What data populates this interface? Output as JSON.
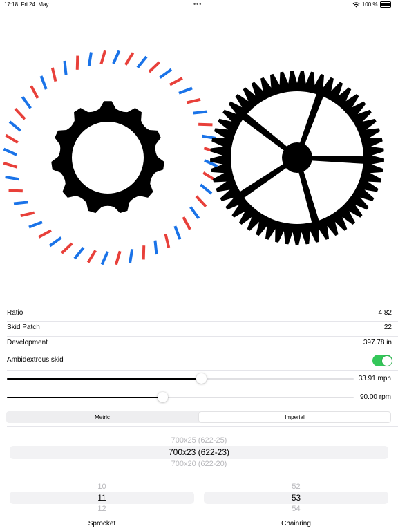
{
  "status_bar": {
    "time": "17:18",
    "date": "Fri 24. May",
    "dots": "•••",
    "battery": "100 %"
  },
  "colors": {
    "accent_red": "#e8403a",
    "accent_blue": "#1a73e8",
    "toggle_on": "#34c759"
  },
  "stats": {
    "ratio_label": "Ratio",
    "ratio_value": "4.82",
    "skid_label": "Skid Patch",
    "skid_value": "22",
    "development_label": "Development",
    "development_value": "397.78 in",
    "ambidextrous_label": "Ambidextrous skid",
    "ambidextrous_on": true
  },
  "sliders": {
    "speed_value": "33.91 mph",
    "speed_fraction": 0.56,
    "cadence_value": "90.00 rpm",
    "cadence_fraction": 0.45
  },
  "units": {
    "metric": "Metric",
    "imperial": "Imperial",
    "selected": "Imperial"
  },
  "tire_picker": {
    "above": "700x25 (622-25)",
    "selected": "700x23 (622-23)",
    "below": "700x20 (622-20)"
  },
  "sprocket_picker": {
    "above": "10",
    "selected": "11",
    "below": "12",
    "label": "Sprocket"
  },
  "chainring_picker": {
    "above": "52",
    "selected": "53",
    "below": "54",
    "label": "Chainring"
  },
  "gears": {
    "sprocket_teeth": 11,
    "chainring_teeth": 53,
    "skid_patches": 22
  }
}
